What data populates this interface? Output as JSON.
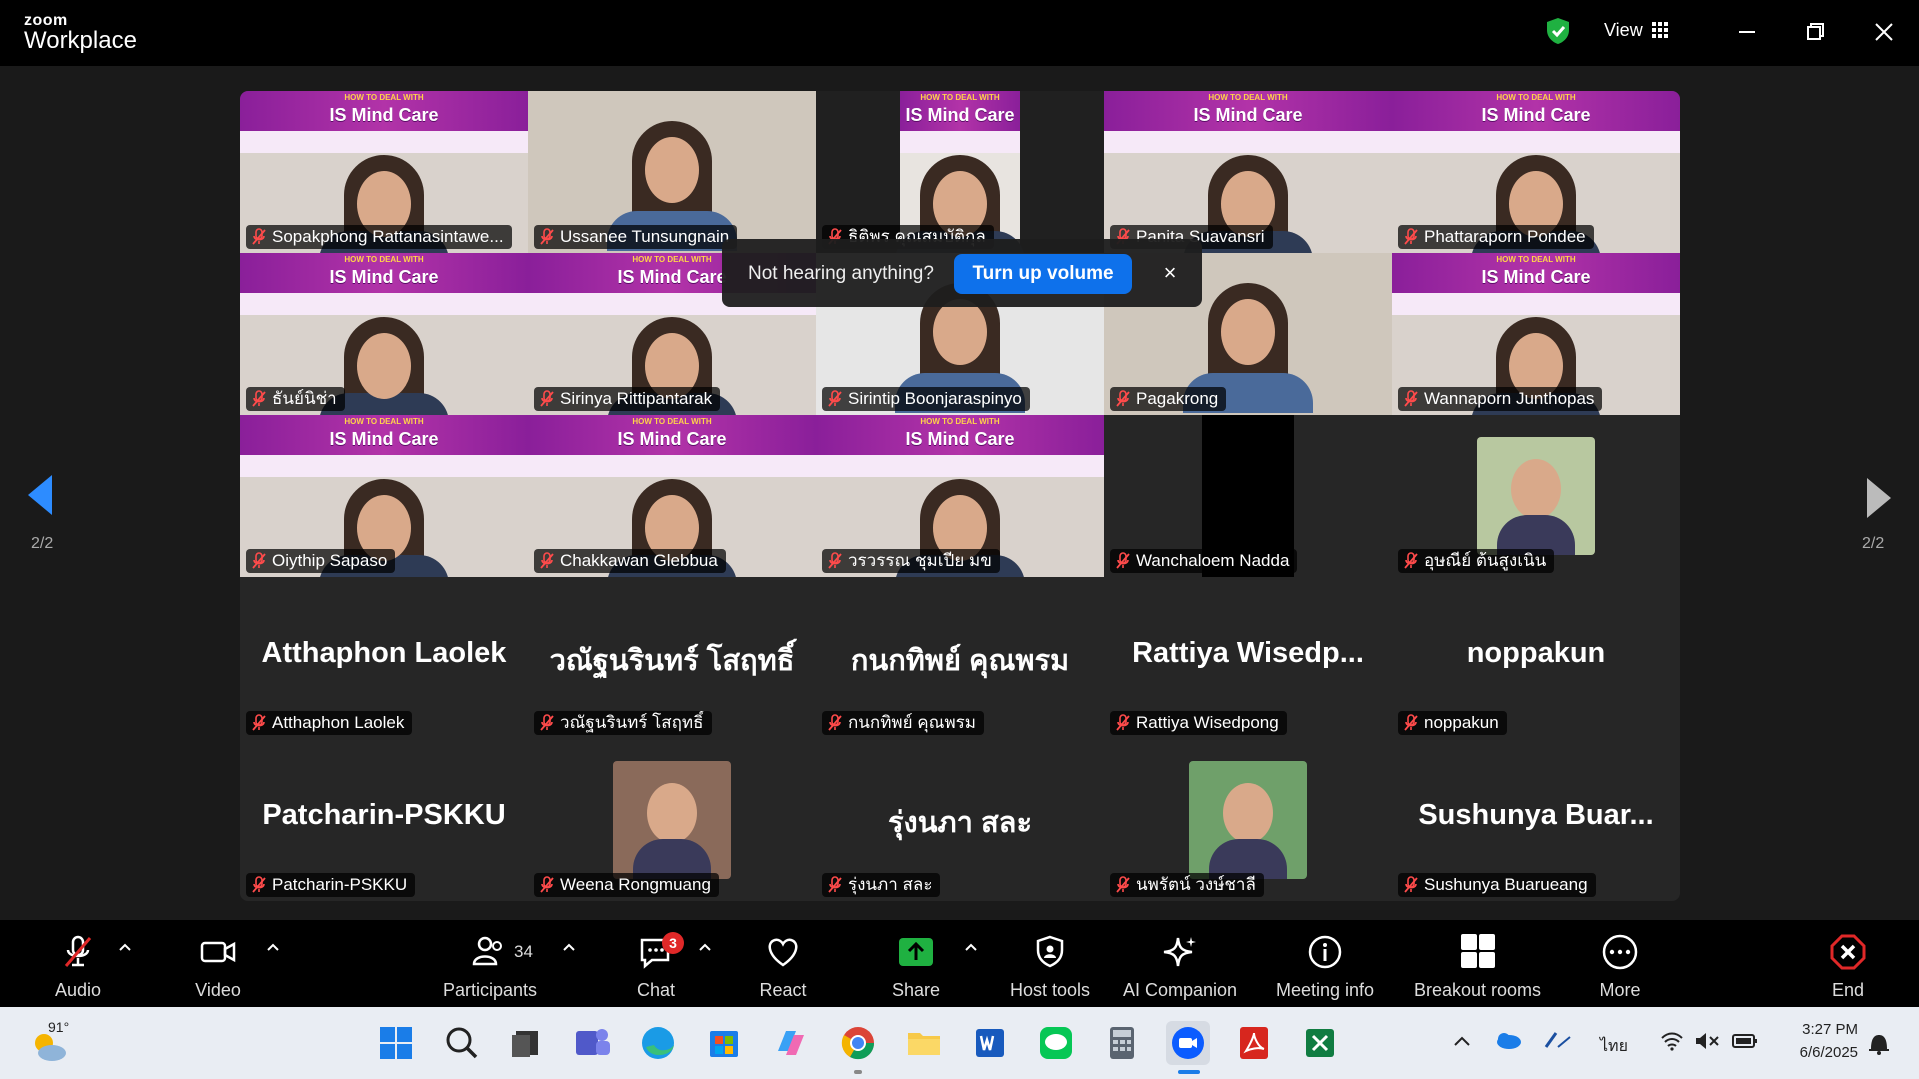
{
  "app": {
    "brand_small": "zoom",
    "brand_big": "Workplace",
    "view_label": "View"
  },
  "pagination": {
    "left": "2/2",
    "right": "2/2"
  },
  "banner": {
    "title": "IS Mind Care",
    "sub": "HOW TO DEAL WITH"
  },
  "tiles": [
    {
      "name": "Sopakphong Rattanasintawe...",
      "type": "banner"
    },
    {
      "name": "Ussanee Tunsungnain",
      "type": "room"
    },
    {
      "name": "ธิติพร คุณสมบัติกุล",
      "type": "narrow"
    },
    {
      "name": "Panita Suavansri",
      "type": "banner-noname"
    },
    {
      "name": "Phattaraporn Pondee",
      "type": "banner"
    },
    {
      "name": "ธันย์นิช่า",
      "type": "banner"
    },
    {
      "name": "Sirinya Rittipantarak",
      "type": "banner"
    },
    {
      "name": "Sirintip Boonjaraspinyo",
      "type": "office"
    },
    {
      "name": "Pagakrong",
      "type": "room"
    },
    {
      "name": "Wannaporn Junthopas",
      "type": "banner"
    },
    {
      "name": "Oiythip Sapaso",
      "type": "banner"
    },
    {
      "name": "Chakkawan Glebbua",
      "type": "banner"
    },
    {
      "name": "วรวรรณ ชุมเปีย มข",
      "type": "banner"
    },
    {
      "name": "Wanchaloem Nadda",
      "type": "black"
    },
    {
      "name": "อุษณีย์ ต้นสูงเนิน",
      "type": "photo"
    },
    {
      "name": "Atthaphon Laolek",
      "type": "text",
      "display": "Atthaphon Laolek"
    },
    {
      "name": "วณัฐนรินทร์ โสฤทธิ์",
      "type": "text",
      "display": "วณัฐนรินทร์ โสฤทธิ์"
    },
    {
      "name": "กนกทิพย์ คุณพรม",
      "type": "text",
      "display": "กนกทิพย์ คุณพรม"
    },
    {
      "name": "Rattiya Wisedpong",
      "type": "text",
      "display": "Rattiya  Wisedp..."
    },
    {
      "name": "noppakun",
      "type": "text",
      "display": "noppakun"
    },
    {
      "name": "Patcharin-PSKKU",
      "type": "text",
      "display": "Patcharin-PSKKU"
    },
    {
      "name": "Weena Rongmuang",
      "type": "photo"
    },
    {
      "name": "รุ่งนภา สละ",
      "type": "text",
      "display": "รุ่งนภา สละ"
    },
    {
      "name": "นพรัตน์ วงษ์ชาลี",
      "type": "photo"
    },
    {
      "name": "Sushunya Buarueang",
      "type": "text",
      "display": "Sushunya  Buar..."
    }
  ],
  "toast": {
    "message": "Not hearing anything?",
    "button": "Turn up volume",
    "close": "×"
  },
  "toolbar": {
    "audio": "Audio",
    "video": "Video",
    "participants": "Participants",
    "participants_count": "34",
    "chat": "Chat",
    "chat_badge": "3",
    "react": "React",
    "share": "Share",
    "host_tools": "Host tools",
    "ai_companion": "AI Companion",
    "meeting_info": "Meeting info",
    "breakout_rooms": "Breakout rooms",
    "more": "More",
    "end": "End"
  },
  "taskbar": {
    "weather_temp": "91°",
    "lang": "ไทย",
    "time": "3:27 PM",
    "date": "6/6/2025"
  },
  "colors": {
    "accent": "#0e71eb",
    "banner_purple": "#8a1f9a",
    "end_red": "#e02828",
    "share_green": "#1fb141"
  }
}
